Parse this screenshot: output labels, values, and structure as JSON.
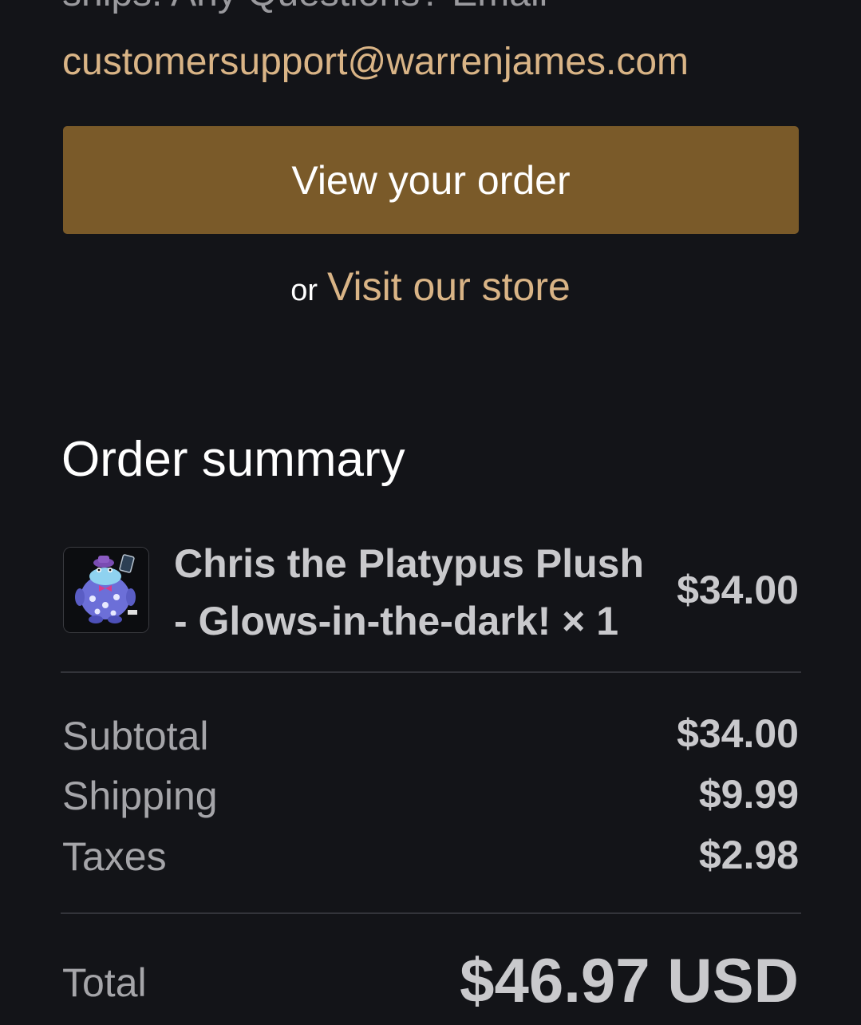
{
  "intro": {
    "cut_text": "ships. Any Questions? Email",
    "email": "customersupport@warrenjames.com"
  },
  "actions": {
    "view_order_label": "View your order",
    "or_text": "or",
    "visit_store_label": "Visit our store"
  },
  "summary": {
    "heading": "Order summary",
    "item": {
      "title_line1": "Chris the Platypus Plush",
      "title_line2": "- Glows-in-the-dark! × 1",
      "price": "$34.00",
      "image": "platypus-plush-image"
    },
    "rows": [
      {
        "label": "Subtotal",
        "value": "$34.00"
      },
      {
        "label": "Shipping",
        "value": "$9.99"
      },
      {
        "label": "Taxes",
        "value": "$2.98"
      }
    ],
    "total_label": "Total",
    "total_value": "$46.97 USD"
  },
  "colors": {
    "background": "#131418",
    "accent_link": "#d9b486",
    "button": "#7a5a29",
    "muted_text": "#a5a5a9",
    "value_text": "#c9c9cc"
  }
}
